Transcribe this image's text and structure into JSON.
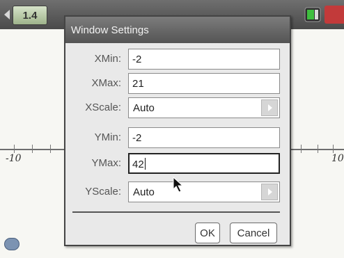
{
  "topbar": {
    "page_tab": "1.4",
    "icons": [
      "left-arrow-icon",
      "battery-icon",
      "close-doc-icon"
    ]
  },
  "graph": {
    "x_axis": {
      "left_label": "-10",
      "right_label": "10"
    }
  },
  "dialog": {
    "title": "Window Settings",
    "fields": [
      {
        "label": "XMin:",
        "value": "-2"
      },
      {
        "label": "XMax:",
        "value": "21"
      },
      {
        "label": "XScale:",
        "value": "Auto"
      },
      {
        "label": "YMin:",
        "value": "-2"
      },
      {
        "label": "YMax:",
        "value": "42"
      },
      {
        "label": "YScale:",
        "value": "Auto"
      }
    ],
    "ok_label": "OK",
    "cancel_label": "Cancel"
  }
}
